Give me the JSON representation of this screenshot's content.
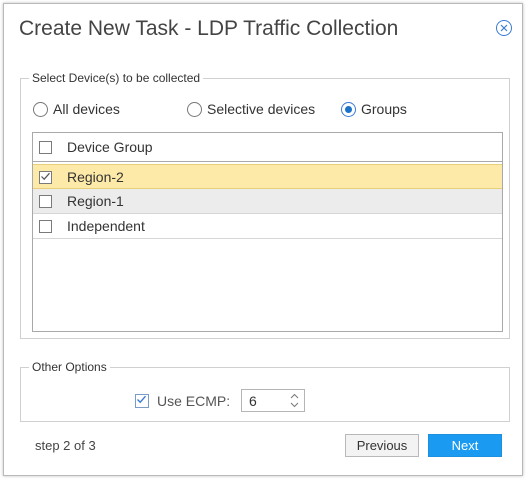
{
  "dialog": {
    "title": "Create New Task - LDP Traffic Collection",
    "close_icon": "close-circle-icon"
  },
  "devices": {
    "legend": "Select Device(s) to be collected",
    "radios": [
      {
        "label": "All devices",
        "checked": false
      },
      {
        "label": "Selective devices",
        "checked": false
      },
      {
        "label": "Groups",
        "checked": true
      }
    ],
    "table": {
      "header": "Device Group",
      "rows": [
        {
          "label": "Region-2",
          "checked": true,
          "highlight": "selected"
        },
        {
          "label": "Region-1",
          "checked": false,
          "highlight": "hover"
        },
        {
          "label": "Independent",
          "checked": false,
          "highlight": "none"
        }
      ]
    }
  },
  "options": {
    "legend": "Other Options",
    "ecmp_label": "Use ECMP:",
    "ecmp_checked": true,
    "ecmp_value": "6"
  },
  "footer": {
    "step": "step 2 of 3",
    "previous_label": "Previous",
    "next_label": "Next"
  },
  "colors": {
    "accent": "#1a9af0",
    "selected_row": "#fdeaa8",
    "hover_row": "#ececec"
  }
}
